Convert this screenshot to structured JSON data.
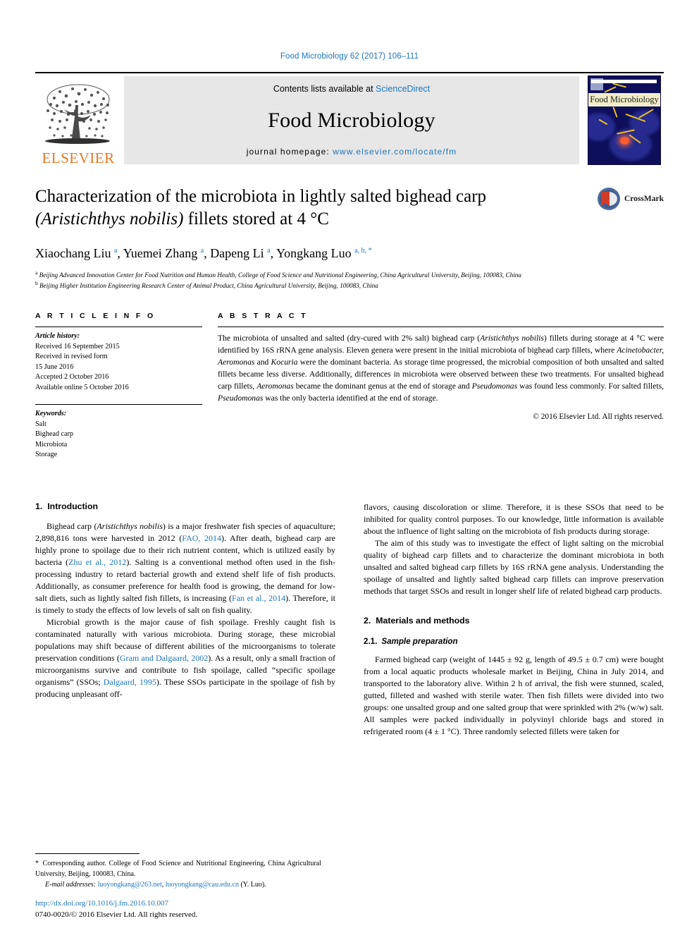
{
  "running_head": "Food Microbiology 62 (2017) 106–111",
  "masthead": {
    "publisher_name": "ELSEVIER",
    "publisher_logo": "elsevier-tree-logo",
    "contents_prefix": "Contents lists available at ",
    "contents_link": "ScienceDirect",
    "journal_name": "Food Microbiology",
    "homepage_prefix": "journal homepage: ",
    "homepage_url": "www.elsevier.com/locate/fm",
    "cover_title": "Food Microbiology"
  },
  "article": {
    "title_line1": "Characterization of the microbiota in lightly salted bighead carp",
    "title_italic": "(Aristichthys nobilis)",
    "title_line2_rest": " fillets stored at 4 °C",
    "authors": [
      {
        "name": "Xiaochang Liu",
        "sup": "a"
      },
      {
        "name": "Yuemei Zhang",
        "sup": "a"
      },
      {
        "name": "Dapeng Li",
        "sup": "a"
      },
      {
        "name": "Yongkang Luo",
        "sup": "a, b, *"
      }
    ],
    "affiliation_a_mark": "a",
    "affiliation_a": "Beijing Advanced Innovation Center for Food Nutrition and Human Health, College of Food Science and Nutritional Engineering, China Agricultural University, Beijing, 100083, China",
    "affiliation_b_mark": "b",
    "affiliation_b": "Beijing Higher Institution Engineering Research Center of Animal Product, China Agricultural University, Beijing, 100083, China",
    "crossmark_label": "CrossMark"
  },
  "article_info": {
    "heading": "A R T I C L E   I N F O",
    "history_label": "Article history:",
    "history": [
      "Received 16 September 2015",
      "Received in revised form",
      "15 June 2016",
      "Accepted 2 October 2016",
      "Available online 5 October 2016"
    ],
    "keywords_label": "Keywords:",
    "keywords": [
      "Salt",
      "Bighead carp",
      "Microbiota",
      "Storage"
    ]
  },
  "abstract": {
    "heading": "A B S T R A C T",
    "p1_a": "The microbiota of unsalted and salted (dry-cured with 2% salt) bighead carp (",
    "p1_it1": "Aristichthys nobilis",
    "p1_b": ") fillets during storage at 4 °C were identified by 16S rRNA gene analysis. Eleven genera were present in the initial microbiota of bighead carp fillets, where ",
    "p1_it2": "Acinetobacter, Aeromonas",
    "p1_c": " and ",
    "p1_it3": "Kocuria",
    "p1_d": " were the dominant bacteria. As storage time progressed, the microbial composition of both unsalted and salted fillets became less diverse. Additionally, differences in microbiota were observed between these two treatments. For unsalted bighead carp fillets, ",
    "p1_it4": "Aeromonas",
    "p1_e": " became the dominant genus at the end of storage and ",
    "p1_it5": "Pseudomonas",
    "p1_f": " was found less commonly. For salted fillets, ",
    "p1_it6": "Pseudomonas",
    "p1_g": " was the only bacteria identified at the end of storage.",
    "copyright": "© 2016 Elsevier Ltd. All rights reserved."
  },
  "body": {
    "left": {
      "h1_num": "1.",
      "h1_label": "Introduction",
      "p1_a": "Bighead carp (",
      "p1_it1": "Aristichthys nobilis",
      "p1_b": ") is a major freshwater fish species of aquaculture; 2,898,816 tons were harvested in 2012 (",
      "p1_ref1": "FAO, 2014",
      "p1_c": "). After death, bighead carp are highly prone to spoilage due to their rich nutrient content, which is utilized easily by bacteria (",
      "p1_ref2": "Zhu et al., 2012",
      "p1_d": "). Salting is a conventional method often used in the fish-processing industry to retard bacterial growth and extend shelf life of fish products. Additionally, as consumer preference for health food is growing, the demand for low-salt diets, such as lightly salted fish fillets, is increasing (",
      "p1_ref3": "Fan et al., 2014",
      "p1_e": "). Therefore, it is timely to study the effects of low levels of salt on fish quality.",
      "p2_a": "Microbial growth is the major cause of fish spoilage. Freshly caught fish is contaminated naturally with various microbiota. During storage, these microbial populations may shift because of different abilities of the microorganisms to tolerate preservation conditions (",
      "p2_ref1": "Gram and Dalgaard, 2002",
      "p2_b": "). As a result, only a small fraction of microorganisms survive and contribute to fish spoilage, called “specific spoilage organisms” (SSOs; ",
      "p2_ref2": "Dalgaard, 1995",
      "p2_c": "). These SSOs participate in the spoilage of fish by producing unpleasant off-"
    },
    "right": {
      "p1": "flavors, causing discoloration or slime. Therefore, it is these SSOs that need to be inhibited for quality control purposes. To our knowledge, little information is available about the influence of light salting on the microbiota of fish products during storage.",
      "p2": "The aim of this study was to investigate the effect of light salting on the microbial quality of bighead carp fillets and to characterize the dominant microbiota in both unsalted and salted bighead carp fillets by 16S rRNA gene analysis. Understanding the spoilage of unsalted and lightly salted bighead carp fillets can improve preservation methods that target SSOs and result in longer shelf life of related bighead carp products.",
      "h1_num": "2.",
      "h1_label": "Materials and methods",
      "h2_num": "2.1.",
      "h2_label": "Sample preparation",
      "p3": "Farmed bighead carp (weight of 1445 ± 92 g, length of 49.5 ± 0.7 cm) were bought from a local aquatic products wholesale market in Beijing, China in July 2014, and transported to the laboratory alive. Within 2 h of arrival, the fish were stunned, scaled, gutted, filleted and washed with sterile water. Then fish fillets were divided into two groups: one unsalted group and one salted group that were sprinkled with 2% (w/w) salt. All samples were packed individually in polyvinyl chloride bags and stored in refrigerated room (4 ± 1 °C). Three randomly selected fillets were taken for"
    }
  },
  "footnote": {
    "star": "*",
    "text_a": " Corresponding author. College of Food Science and Nutritional Engineering, China Agricultural University, Beijing, 100083, China.",
    "email_label": "E-mail addresses:",
    "email1": "luoyongkang@263.net",
    "email_sep": ", ",
    "email2": "luoyongkang@cau.edu.cn",
    "email_suffix": " (Y. Luo)."
  },
  "page_footer": {
    "doi": "http://dx.doi.org/10.1016/j.fm.2016.10.007",
    "issn": "0740-0020/© 2016 Elsevier Ltd. All rights reserved."
  },
  "colors": {
    "link": "#1c75bc",
    "elsevier_orange": "#e87722",
    "masthead_grey": "#e7e7e7",
    "cover_blue": "#0d0f5a"
  }
}
